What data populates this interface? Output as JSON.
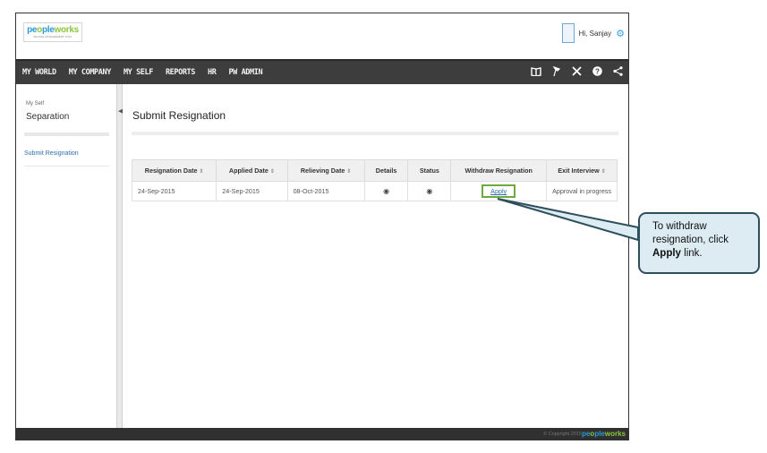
{
  "brand": {
    "name_pre": "pe",
    "name_o": "o",
    "name_mid": "ple",
    "name_post": "works",
    "tagline": "PEOPLE MANAGEMENT TOOL"
  },
  "user": {
    "greeting": "Hi, Sanjay"
  },
  "nav": {
    "items": [
      "MY WORLD",
      "MY COMPANY",
      "MY SELF",
      "REPORTS",
      "HR",
      "PW ADMIN"
    ]
  },
  "icons": {
    "book": "book-icon",
    "pin": "pin-icon",
    "tools": "tools-icon",
    "help": "help-icon",
    "share": "share-icon",
    "gear": "gear-icon",
    "eye": "eye-icon"
  },
  "sidebar": {
    "breadcrumb": "My Self",
    "title": "Separation",
    "link": "Submit Resignation"
  },
  "page": {
    "title": "Submit Resignation"
  },
  "table": {
    "headers": [
      "Resignation Date",
      "Applied Date",
      "Relieving Date",
      "Details",
      "Status",
      "Withdraw Resignation",
      "Exit Interview"
    ],
    "sortable": [
      true,
      true,
      true,
      false,
      false,
      false,
      true
    ],
    "row": {
      "resignation_date": "24-Sep-2015",
      "applied_date": "24-Sep-2015",
      "relieving_date": "08-Oct-2015",
      "withdraw": "Apply",
      "exit_interview": "Approval in progress"
    }
  },
  "footer": {
    "copyright": "© Copyright 2015"
  },
  "callout": {
    "pre": "To withdraw resignation, click ",
    "bold": "Apply",
    "post": " link."
  },
  "colors": {
    "nav_bg": "#3d3d3d",
    "link": "#2f6fb0",
    "highlight": "#70a840",
    "callout_bg": "#dcecf2",
    "callout_border": "#2e4f5c",
    "brand_blue": "#2a9bd6",
    "brand_green": "#8cc63f"
  }
}
